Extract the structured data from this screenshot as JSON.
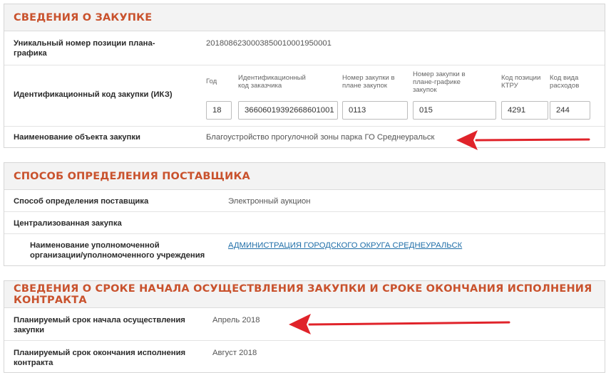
{
  "section1": {
    "title": "СВЕДЕНИЯ О ЗАКУПКЕ",
    "unique_label": "Уникальный номер позиции плана-графика",
    "unique_value": "2018086230003850010001950001",
    "ikz_label": "Идентификационный код закупки (ИКЗ)",
    "ikz_fields": [
      {
        "caption": "Год",
        "value": "18"
      },
      {
        "caption": "Идентификационный код заказчика",
        "value": "3660601939266860100 1"
      },
      {
        "caption": "Номер закупки в плане закупок",
        "value": "0113"
      },
      {
        "caption": "Номер закупки в плане-графике закупок",
        "value": "015"
      },
      {
        "caption": "Код позиции КТРУ",
        "value": "4291"
      },
      {
        "caption": "Код вида расходов",
        "value": "244"
      }
    ],
    "object_label": "Наименование объекта закупки",
    "object_value": "Благоустройство прогулочной зоны парка ГО Среднеуральск"
  },
  "section2": {
    "title": "СПОСОБ ОПРЕДЕЛЕНИЯ ПОСТАВЩИКА",
    "method_label": "Способ определения поставщика",
    "method_value": "Электронный аукцион",
    "central_label": "Централизованная закупка",
    "org_label": "Наименование уполномоченной организации/уполномоченного учреждения",
    "org_value": "АДМИНИСТРАЦИЯ ГОРОДСКОГО ОКРУГА СРЕДНЕУРАЛЬСК"
  },
  "section3": {
    "title": "СВЕДЕНИЯ О СРОКЕ НАЧАЛА ОСУЩЕСТВЛЕНИЯ ЗАКУПКИ И СРОКЕ ОКОНЧАНИЯ ИСПОЛНЕНИЯ КОНТРАКТА",
    "start_label": "Планируемый срок начала осуществления закупки",
    "start_value": "Апрель 2018",
    "end_label": "Планируемый срок окончания исполнения контракта",
    "end_value": "Август 2018"
  },
  "colors": {
    "accent": "#c9522d",
    "arrow": "#e0232a",
    "link": "#1f6ea8"
  }
}
